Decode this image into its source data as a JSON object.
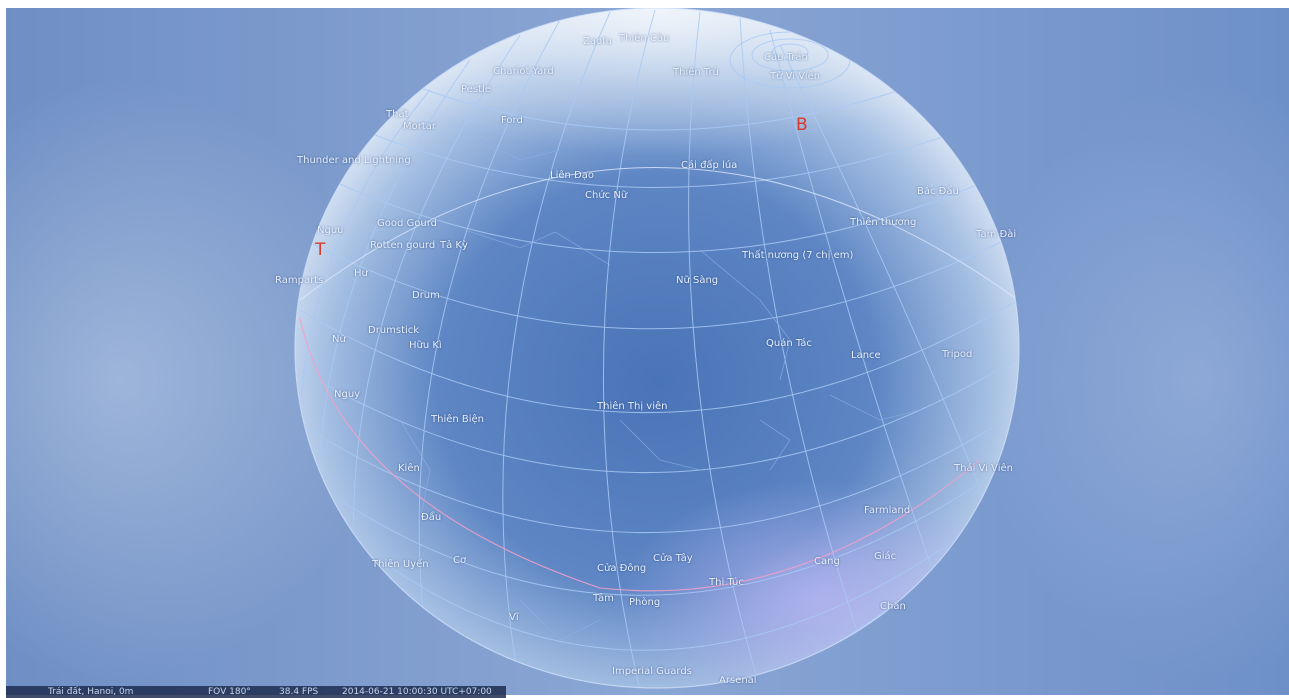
{
  "app": "Stellarium",
  "status": {
    "location": "Trái đất, Hanoi, 0m",
    "fov": "FOV 180°",
    "fps": "38.4 FPS",
    "datetime": "2014-06-21   10:00:30 UTC+07:00"
  },
  "cardinals": {
    "south": "T",
    "north": "B"
  },
  "constellations": [
    "Zaofu",
    "Thiên Câu",
    "Chariot Yard",
    "Thiên Trù",
    "Câu Trần",
    "Tử Vi Viên",
    "Pestle",
    "Thất",
    "Mortar",
    "Ford",
    "Thunder and Lightning",
    "Liên Đạo",
    "Cái đấp lúa",
    "Chức Nữ",
    "Bắc Đẩu",
    "Thiên thương",
    "Tam Đài",
    "Ngưu",
    "Good Gourd",
    "Rotten gourd",
    "Tả Kỳ",
    "Thất nương (7 chị em)",
    "Ramparts",
    "Hư",
    "Nữ Sàng",
    "Drum",
    "Drumstick",
    "Nữ",
    "Hữu Kì",
    "Quán Tác",
    "Lance",
    "Tripod",
    "Nguy",
    "Thiên Thị viên",
    "Thiên Biện",
    "Thái Vi Viên",
    "Kiên",
    "Farmland",
    "Đẩu",
    "Cửa Tây",
    "Cang",
    "Giác",
    "Thiên Uyển",
    "Cơ",
    "Cửa Đông",
    "Thi Túc",
    "Tâm",
    "Phòng",
    "Chẩn",
    "Vĩ",
    "Imperial Guards",
    "Arsenal"
  ]
}
